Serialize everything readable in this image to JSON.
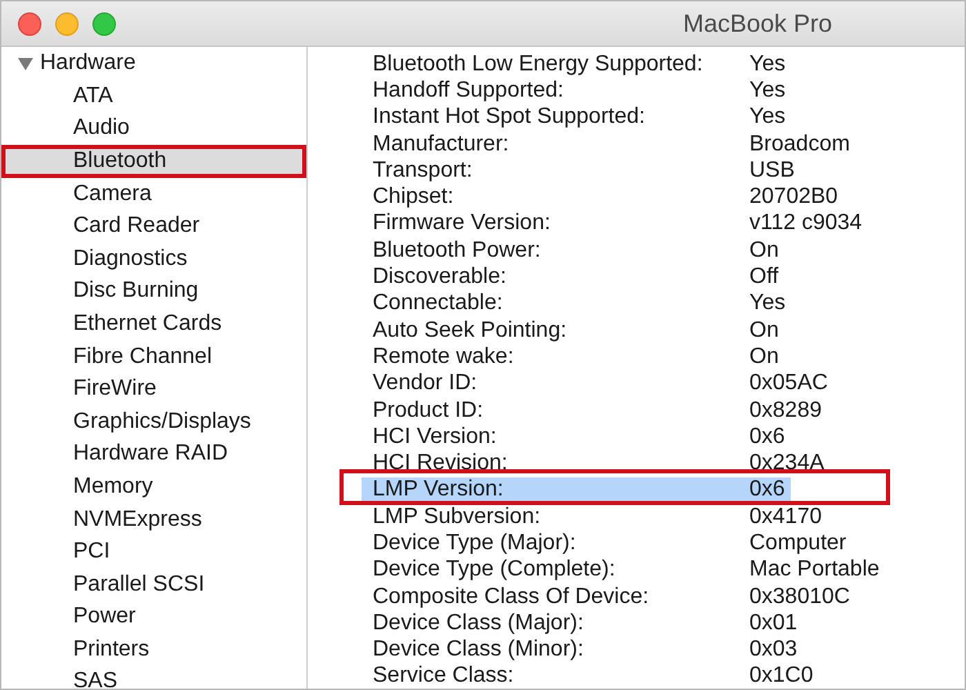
{
  "window": {
    "title": "MacBook Pro"
  },
  "sidebar": {
    "group": {
      "label": "Hardware",
      "expanded": true
    },
    "items": [
      {
        "label": "ATA",
        "selected": false,
        "highlighted": false
      },
      {
        "label": "Audio",
        "selected": false,
        "highlighted": false
      },
      {
        "label": "Bluetooth",
        "selected": true,
        "highlighted": true
      },
      {
        "label": "Camera",
        "selected": false,
        "highlighted": false
      },
      {
        "label": "Card Reader",
        "selected": false,
        "highlighted": false
      },
      {
        "label": "Diagnostics",
        "selected": false,
        "highlighted": false
      },
      {
        "label": "Disc Burning",
        "selected": false,
        "highlighted": false
      },
      {
        "label": "Ethernet Cards",
        "selected": false,
        "highlighted": false
      },
      {
        "label": "Fibre Channel",
        "selected": false,
        "highlighted": false
      },
      {
        "label": "FireWire",
        "selected": false,
        "highlighted": false
      },
      {
        "label": "Graphics/Displays",
        "selected": false,
        "highlighted": false
      },
      {
        "label": "Hardware RAID",
        "selected": false,
        "highlighted": false
      },
      {
        "label": "Memory",
        "selected": false,
        "highlighted": false
      },
      {
        "label": "NVMExpress",
        "selected": false,
        "highlighted": false
      },
      {
        "label": "PCI",
        "selected": false,
        "highlighted": false
      },
      {
        "label": "Parallel SCSI",
        "selected": false,
        "highlighted": false
      },
      {
        "label": "Power",
        "selected": false,
        "highlighted": false
      },
      {
        "label": "Printers",
        "selected": false,
        "highlighted": false
      },
      {
        "label": "SAS",
        "selected": false,
        "highlighted": false
      }
    ]
  },
  "details": {
    "rows": [
      {
        "label": "Bluetooth Low Energy Supported:",
        "value": "Yes",
        "selected": false,
        "highlighted": false
      },
      {
        "label": "Handoff Supported:",
        "value": "Yes",
        "selected": false,
        "highlighted": false
      },
      {
        "label": "Instant Hot Spot Supported:",
        "value": "Yes",
        "selected": false,
        "highlighted": false
      },
      {
        "label": "Manufacturer:",
        "value": "Broadcom",
        "selected": false,
        "highlighted": false
      },
      {
        "label": "Transport:",
        "value": "USB",
        "selected": false,
        "highlighted": false
      },
      {
        "label": "Chipset:",
        "value": "20702B0",
        "selected": false,
        "highlighted": false
      },
      {
        "label": "Firmware Version:",
        "value": "v112 c9034",
        "selected": false,
        "highlighted": false
      },
      {
        "label": "Bluetooth Power:",
        "value": "On",
        "selected": false,
        "highlighted": false
      },
      {
        "label": "Discoverable:",
        "value": "Off",
        "selected": false,
        "highlighted": false
      },
      {
        "label": "Connectable:",
        "value": "Yes",
        "selected": false,
        "highlighted": false
      },
      {
        "label": "Auto Seek Pointing:",
        "value": "On",
        "selected": false,
        "highlighted": false
      },
      {
        "label": "Remote wake:",
        "value": "On",
        "selected": false,
        "highlighted": false
      },
      {
        "label": "Vendor ID:",
        "value": "0x05AC",
        "selected": false,
        "highlighted": false
      },
      {
        "label": "Product ID:",
        "value": "0x8289",
        "selected": false,
        "highlighted": false
      },
      {
        "label": "HCI Version:",
        "value": "0x6",
        "selected": false,
        "highlighted": false
      },
      {
        "label": "HCI Revision:",
        "value": "0x234A",
        "selected": false,
        "highlighted": false
      },
      {
        "label": "LMP Version:",
        "value": "0x6",
        "selected": true,
        "highlighted": true
      },
      {
        "label": "LMP Subversion:",
        "value": "0x4170",
        "selected": false,
        "highlighted": false
      },
      {
        "label": "Device Type (Major):",
        "value": "Computer",
        "selected": false,
        "highlighted": false
      },
      {
        "label": "Device Type (Complete):",
        "value": "Mac Portable",
        "selected": false,
        "highlighted": false
      },
      {
        "label": "Composite Class Of Device:",
        "value": "0x38010C",
        "selected": false,
        "highlighted": false
      },
      {
        "label": "Device Class (Major):",
        "value": "0x01",
        "selected": false,
        "highlighted": false
      },
      {
        "label": "Device Class (Minor):",
        "value": "0x03",
        "selected": false,
        "highlighted": false
      },
      {
        "label": "Service Class:",
        "value": "0x1C0",
        "selected": false,
        "highlighted": false
      }
    ]
  }
}
